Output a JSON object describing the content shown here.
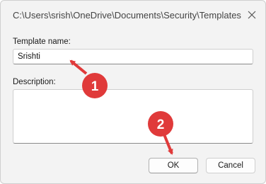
{
  "window": {
    "title": "C:\\Users\\srish\\OneDrive\\Documents\\Security\\Templates",
    "close_icon": "close-icon"
  },
  "form": {
    "template_name_label": "Template name:",
    "template_name_value": "Srishti",
    "description_label": "Description:",
    "description_value": ""
  },
  "buttons": {
    "ok_label": "OK",
    "cancel_label": "Cancel"
  },
  "callouts": [
    {
      "number": "1"
    },
    {
      "number": "2"
    }
  ],
  "colors": {
    "callout_fill": "#e03a3a",
    "dialog_background": "#f3f3f3"
  }
}
